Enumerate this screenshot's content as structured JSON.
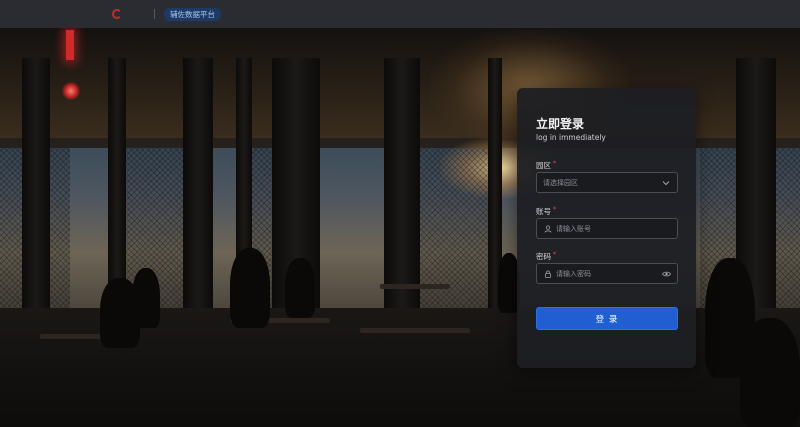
{
  "header": {
    "logo_text": "",
    "platform_badge": "辅佐数据平台"
  },
  "login": {
    "title": "立即登录",
    "subtitle": "log in immediately",
    "park_label": "园区",
    "park_placeholder": "请选择园区",
    "account_label": "账号",
    "account_placeholder": "请输入账号",
    "password_label": "密码",
    "password_placeholder": "请输入密码",
    "required_mark": "*",
    "submit_label": "登 录"
  },
  "icons": {
    "park_select": "chevron-down-icon",
    "account": "user-icon",
    "password": "lock-icon",
    "password_toggle": "eye-icon"
  },
  "colors": {
    "accent": "#1f5fd1",
    "card_bg": "#1e1f23",
    "topbar_bg": "#2a2c31",
    "required": "#e05a5a"
  }
}
